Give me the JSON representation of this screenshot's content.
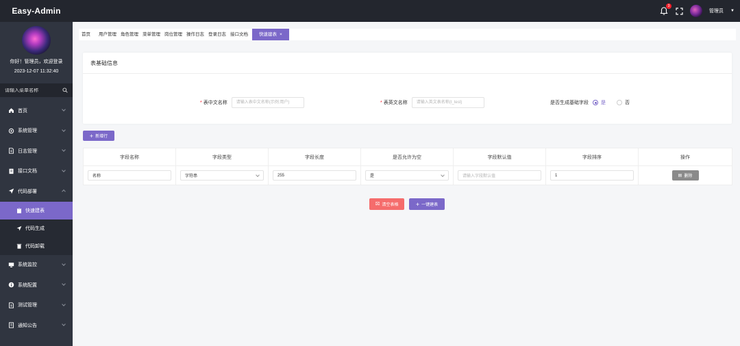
{
  "app": {
    "logo": "Easy-Admin"
  },
  "header": {
    "notification_count": "3",
    "user_name": "管理员"
  },
  "sidebar": {
    "welcome": "你好！管理员，欢迎登录",
    "datetime": "2023-12-07 11:32:40",
    "search_placeholder": "请输入菜单名称",
    "items": [
      {
        "label": "首页"
      },
      {
        "label": "系统管理"
      },
      {
        "label": "日志管理"
      },
      {
        "label": "接口文档"
      },
      {
        "label": "代码部署"
      },
      {
        "label": "系统监控"
      },
      {
        "label": "系统配置"
      },
      {
        "label": "测试管理"
      },
      {
        "label": "通知公告"
      }
    ],
    "sub_items": [
      {
        "label": "快速建表"
      },
      {
        "label": "代码生成"
      },
      {
        "label": "代码卸载"
      }
    ]
  },
  "tabs": [
    {
      "label": "首页"
    },
    {
      "label": "用户管理"
    },
    {
      "label": "角色管理"
    },
    {
      "label": "菜单管理"
    },
    {
      "label": "岗位管理"
    },
    {
      "label": "操作日志"
    },
    {
      "label": "登录日志"
    },
    {
      "label": "接口文档"
    },
    {
      "label": "快速建表",
      "close": "×"
    }
  ],
  "form": {
    "card_title": "表基础信息",
    "cn_name_label": "表中文名称",
    "cn_name_placeholder": "请输入表中文名称(示例:用户)",
    "en_name_label": "表英文名称",
    "en_name_placeholder": "请输入英文表名称(t_test)",
    "base_fields_label": "是否生成基础字段",
    "option_yes": "是",
    "option_no": "否"
  },
  "buttons": {
    "add_row": "新增行",
    "clear": "清空表格",
    "create": "一键建表",
    "delete": "删除"
  },
  "table": {
    "headers": [
      "字段名称",
      "字段类型",
      "字段长度",
      "是否允许为空",
      "字段默认值",
      "字段排序",
      "操作"
    ],
    "rows": [
      {
        "name": "名称",
        "type": "字符串",
        "length": "255",
        "nullable": "是",
        "default_placeholder": "请输入字段默认值",
        "sort": "1"
      }
    ]
  },
  "colors": {
    "accent": "#7b68c9",
    "danger": "#f56c6c",
    "sidebar": "#303540",
    "topbar": "#23262e"
  }
}
